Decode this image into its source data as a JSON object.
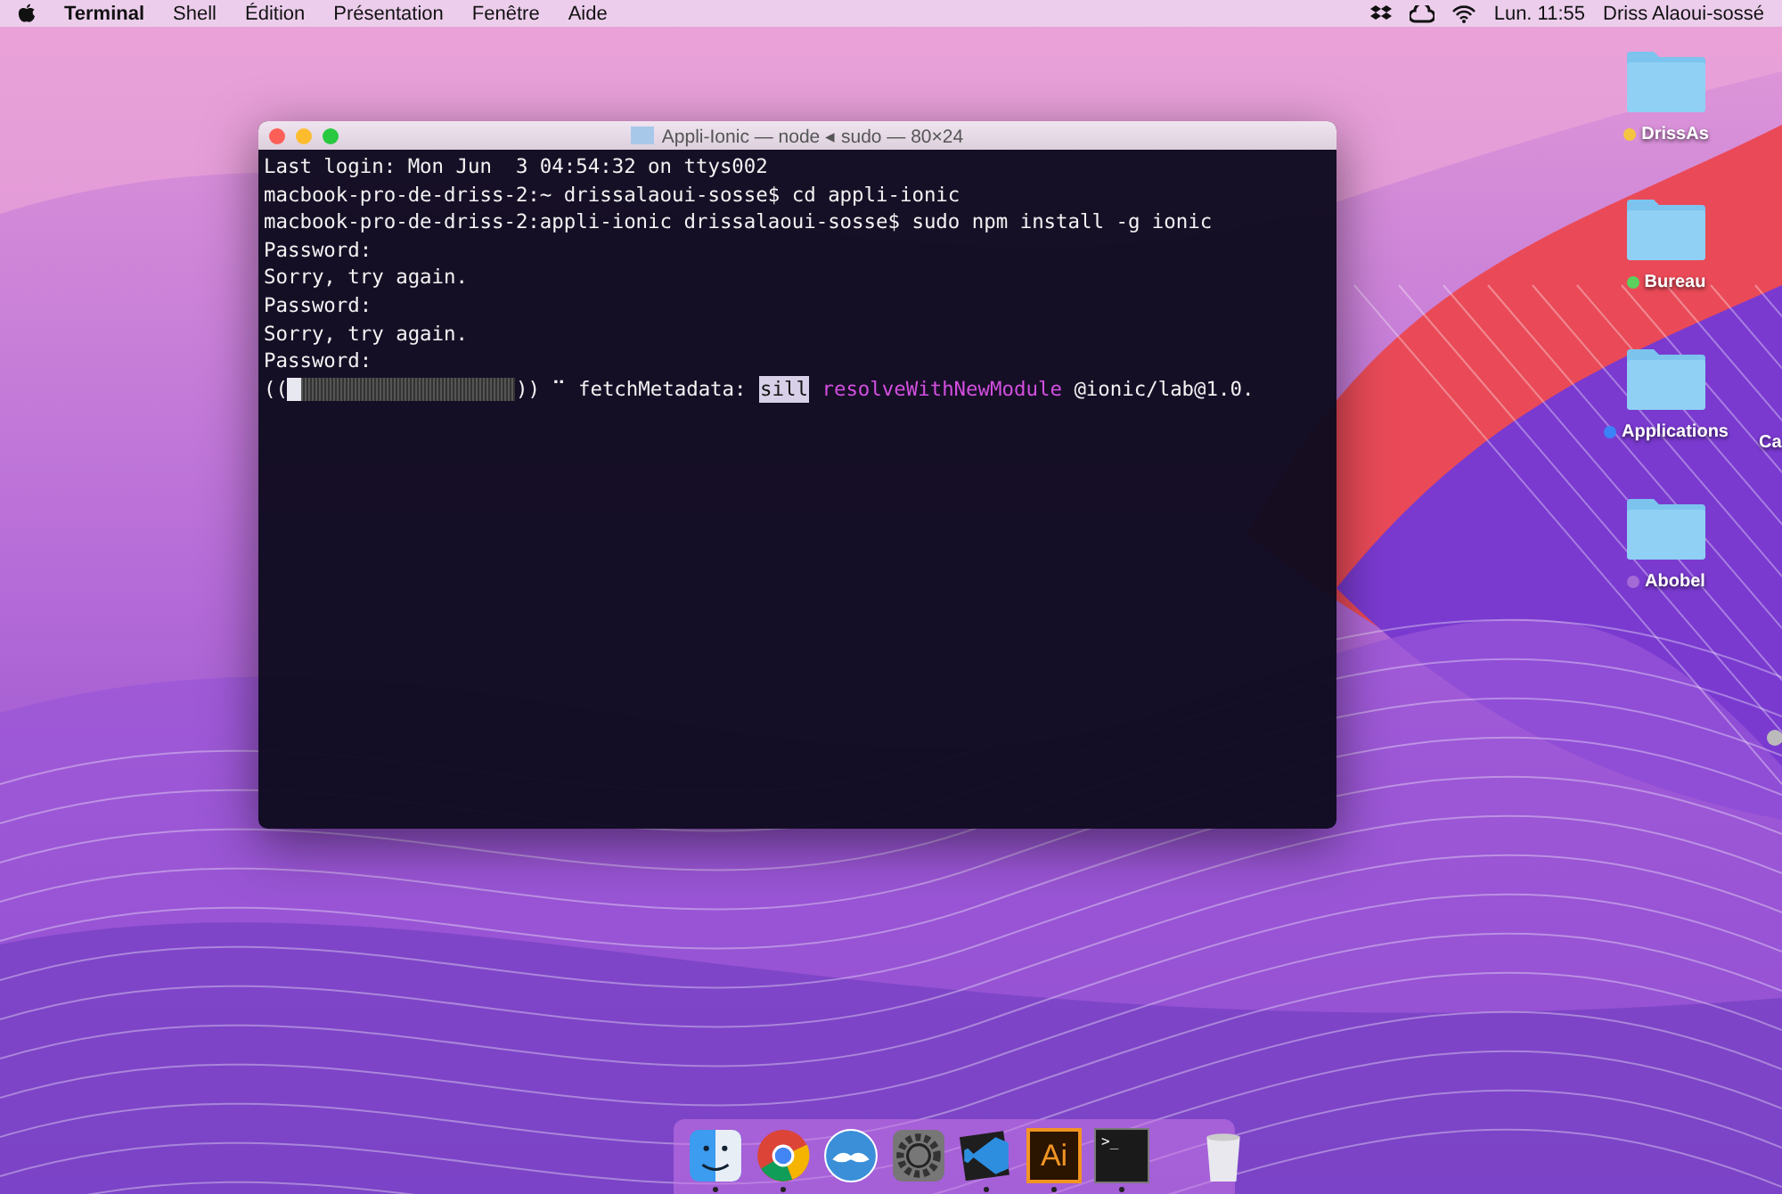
{
  "menu_bar": {
    "app": "Terminal",
    "menus": [
      "Shell",
      "Édition",
      "Présentation",
      "Fenêtre",
      "Aide"
    ],
    "clock": "Lun. 11:55",
    "user": "Driss Alaoui-sossé"
  },
  "desktop_icons": [
    {
      "label": "DrissAs",
      "color": "#f5c542"
    },
    {
      "label": "Bureau",
      "color": "#5ccf5c"
    },
    {
      "label": "Applications",
      "color": "#3b82f6"
    },
    {
      "label": "Abobel",
      "color": "#a46ad6"
    }
  ],
  "cut_label": "Ca",
  "terminal": {
    "title": "Appli-Ionic — node ◂ sudo — 80×24",
    "lines": [
      "Last login: Mon Jun  3 04:54:32 on ttys002",
      "macbook-pro-de-driss-2:~ drissalaoui-sosse$ cd appli-ionic",
      "macbook-pro-de-driss-2:appli-ionic drissalaoui-sosse$ sudo npm install -g ionic",
      "Password:",
      "Sorry, try again.",
      "Password:",
      "Sorry, try again.",
      "Password:"
    ],
    "progress": {
      "open": "((",
      "level": 0.06,
      "close": "))",
      "spinner": "⠉",
      "stage": "fetchMetadata:",
      "badge": "sill",
      "action": "resolveWithNewModule",
      "package": "@ionic/lab@1.0."
    }
  },
  "dock": [
    {
      "kind": "finder",
      "running": true
    },
    {
      "kind": "chrome",
      "running": true
    },
    {
      "kind": "mustache",
      "running": false
    },
    {
      "kind": "settings",
      "running": false
    },
    {
      "kind": "vscode",
      "running": true
    },
    {
      "kind": "illustrator",
      "label": "Ai",
      "running": true
    },
    {
      "kind": "terminal",
      "label": ">_",
      "running": true
    },
    {
      "kind": "trash",
      "running": false
    }
  ]
}
